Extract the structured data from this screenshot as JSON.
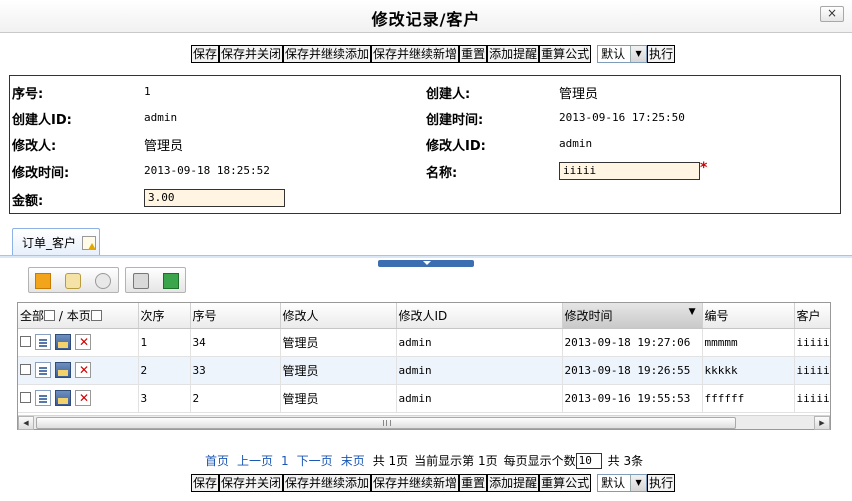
{
  "window": {
    "title": "修改记录/客户",
    "close_label": "×"
  },
  "toolbar": {
    "buttons": [
      "保存",
      "保存并关闭",
      "保存并继续添加",
      "保存并继续新增",
      "重置",
      "添加提醒",
      "重算公式"
    ],
    "select_value": "默认",
    "execute_label": "执行"
  },
  "form": {
    "seq_label": "序号:",
    "seq_value": "1",
    "creator_label": "创建人:",
    "creator_value": "管理员",
    "creator_id_label": "创建人ID:",
    "creator_id_value": "admin",
    "created_time_label": "创建时间:",
    "created_time_value": "2013-09-16 17:25:50",
    "modifier_label": "修改人:",
    "modifier_value": "管理员",
    "modifier_id_label": "修改人ID:",
    "modifier_id_value": "admin",
    "modified_time_label": "修改时间:",
    "modified_time_value": "2013-09-18 18:25:52",
    "name_label": "名称:",
    "name_value": "iiiii",
    "required_mark": "*",
    "amount_label": "金额:",
    "amount_value": "3.00"
  },
  "tab": {
    "label": "订单_客户"
  },
  "grid": {
    "select_all_label": "全部",
    "separator": "/",
    "this_page_label": "本页",
    "columns": [
      "次序",
      "序号",
      "修改人",
      "修改人ID",
      "修改时间",
      "编号",
      "客户"
    ],
    "sorted_column": "修改时间",
    "rows": [
      [
        "1",
        "34",
        "管理员",
        "admin",
        "2013-09-18 19:27:06",
        "mmmmm",
        "iiiii"
      ],
      [
        "2",
        "33",
        "管理员",
        "admin",
        "2013-09-18 19:26:55",
        "kkkkk",
        "iiiii"
      ],
      [
        "3",
        "2",
        "管理员",
        "admin",
        "2013-09-16 19:55:53",
        "ffffff",
        "iiiii"
      ]
    ]
  },
  "pager": {
    "first": "首页",
    "prev": "上一页",
    "current": "1",
    "next": "下一页",
    "last": "末页",
    "total_pages": "共 1页",
    "current_text": "当前显示第 1页",
    "per_page_label": "每页显示个数",
    "per_page_value": "10",
    "total_records": "共 3条"
  },
  "icons": [
    "add-record-icon",
    "edit-batch-icon",
    "delete-batch-icon",
    "print-icon",
    "export-icon"
  ]
}
